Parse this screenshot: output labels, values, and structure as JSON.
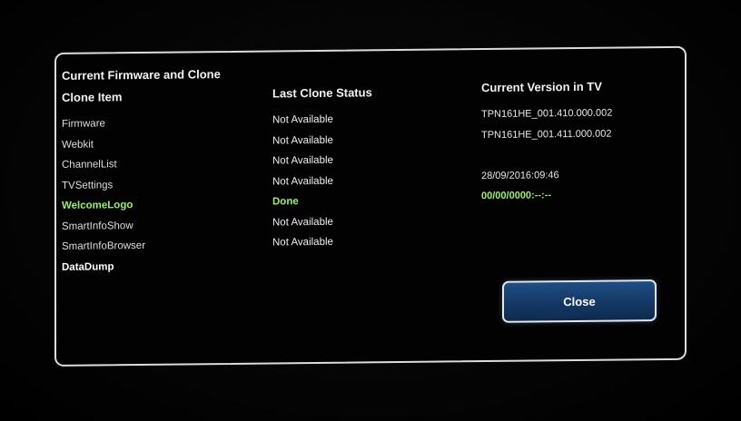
{
  "dialog": {
    "title": "Current Firmware and Clone",
    "columns": {
      "item": "Clone Item",
      "status": "Last Clone Status",
      "version": "Current Version in TV"
    },
    "items": [
      "Firmware",
      "Webkit",
      "ChannelList",
      "TVSettings",
      "WelcomeLogo",
      "SmartInfoShow",
      "SmartInfoBrowser",
      "DataDump"
    ],
    "statuses": [
      "Not Available",
      "Not Available",
      "Not Available",
      "Not Available",
      "Done",
      "Not Available",
      "Not Available"
    ],
    "versions": [
      "TPN161HE_001.410.000.002",
      "TPN161HE_001.411.000.002",
      "",
      "28/09/2016:09:46",
      "00/00/0000:--:--"
    ],
    "close_label": "Close"
  },
  "colors": {
    "highlight_green": "#9cf25a",
    "button_blue": "#163c6a",
    "border": "#dcdcdc"
  }
}
